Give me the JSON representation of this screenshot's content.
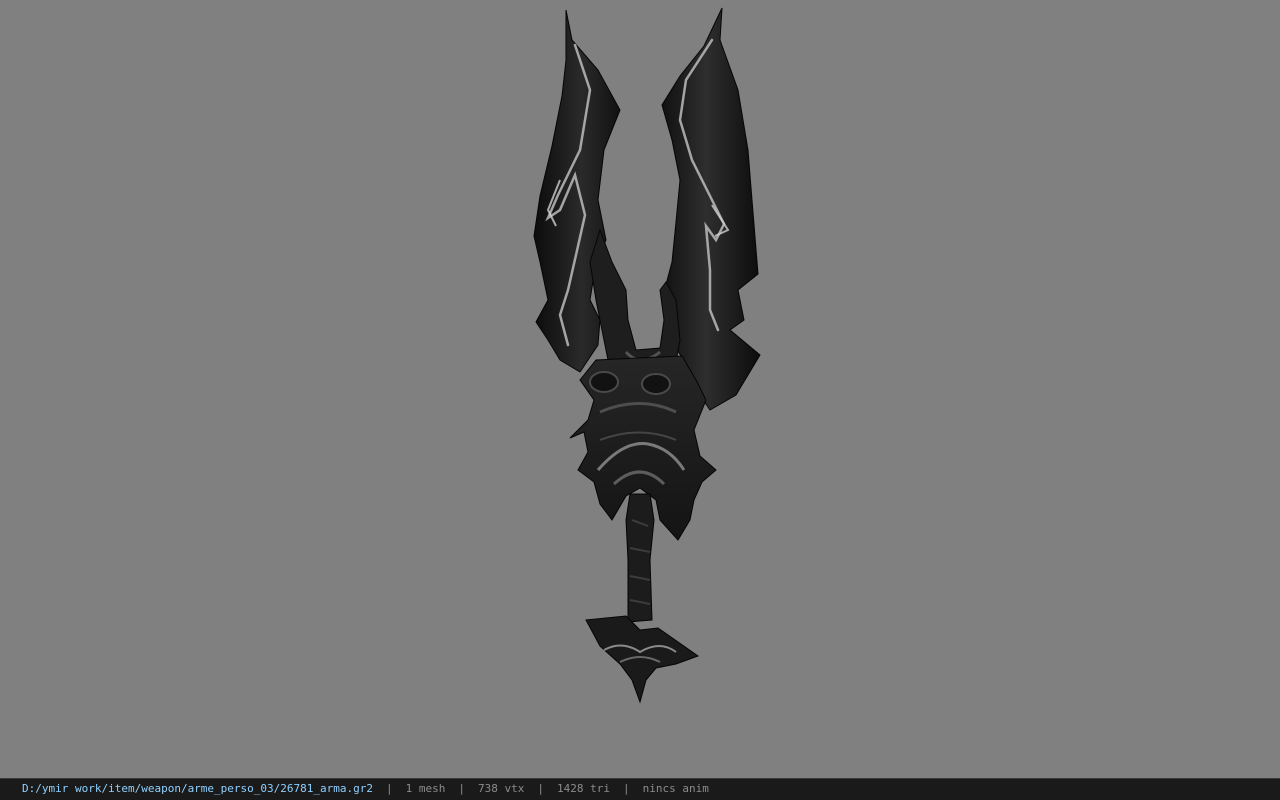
{
  "viewer": {
    "background_color": "#808080",
    "model": {
      "icon": "sword-weapon-3d-model"
    }
  },
  "status_bar": {
    "file_path": "D:/ymir work/item/weapon/arme_perso_03/26781_arma.gr2",
    "separator": "|",
    "mesh_count": "1 mesh",
    "vertex_count": "738 vtx",
    "triangle_count": "1428 tri",
    "anim_status": "nincs anim",
    "path_color": "#8fd0ff",
    "text_color": "#8c8c8c"
  }
}
